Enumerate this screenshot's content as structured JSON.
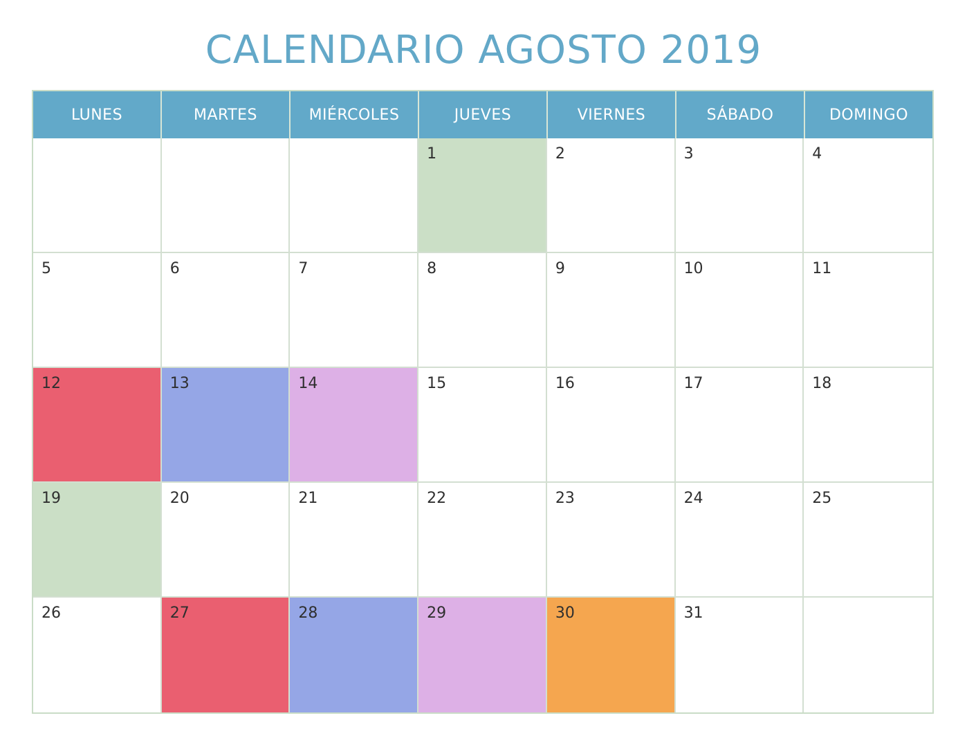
{
  "title": "CALENDARIO AGOSTO 2019",
  "weekdays": [
    "LUNES",
    "MARTES",
    "MIÉRCOLES",
    "JUEVES",
    "VIERNES",
    "SÁBADO",
    "DOMINGO"
  ],
  "colors": {
    "title": "#63a8c8",
    "header": "#62a9c9",
    "green": "#cbdfc6",
    "red": "#ea5f70",
    "blue": "#95a6e6",
    "purple": "#ddb0e6",
    "orange": "#f5a64f",
    "white": "#ffffff"
  },
  "days": [
    {
      "n": "",
      "c": "white"
    },
    {
      "n": "",
      "c": "white"
    },
    {
      "n": "",
      "c": "white"
    },
    {
      "n": "1",
      "c": "green"
    },
    {
      "n": "2",
      "c": "white"
    },
    {
      "n": "3",
      "c": "white"
    },
    {
      "n": "4",
      "c": "white"
    },
    {
      "n": "5",
      "c": "white"
    },
    {
      "n": "6",
      "c": "white"
    },
    {
      "n": "7",
      "c": "white"
    },
    {
      "n": "8",
      "c": "white"
    },
    {
      "n": "9",
      "c": "white"
    },
    {
      "n": "10",
      "c": "white"
    },
    {
      "n": "11",
      "c": "white"
    },
    {
      "n": "12",
      "c": "red"
    },
    {
      "n": "13",
      "c": "blue"
    },
    {
      "n": "14",
      "c": "purple"
    },
    {
      "n": "15",
      "c": "white"
    },
    {
      "n": "16",
      "c": "white"
    },
    {
      "n": "17",
      "c": "white"
    },
    {
      "n": "18",
      "c": "white"
    },
    {
      "n": "19",
      "c": "green"
    },
    {
      "n": "20",
      "c": "white"
    },
    {
      "n": "21",
      "c": "white"
    },
    {
      "n": "22",
      "c": "white"
    },
    {
      "n": "23",
      "c": "white"
    },
    {
      "n": "24",
      "c": "white"
    },
    {
      "n": "25",
      "c": "white"
    },
    {
      "n": "26",
      "c": "white"
    },
    {
      "n": "27",
      "c": "red"
    },
    {
      "n": "28",
      "c": "blue"
    },
    {
      "n": "29",
      "c": "purple"
    },
    {
      "n": "30",
      "c": "orange"
    },
    {
      "n": "31",
      "c": "white"
    },
    {
      "n": "",
      "c": "white"
    }
  ]
}
